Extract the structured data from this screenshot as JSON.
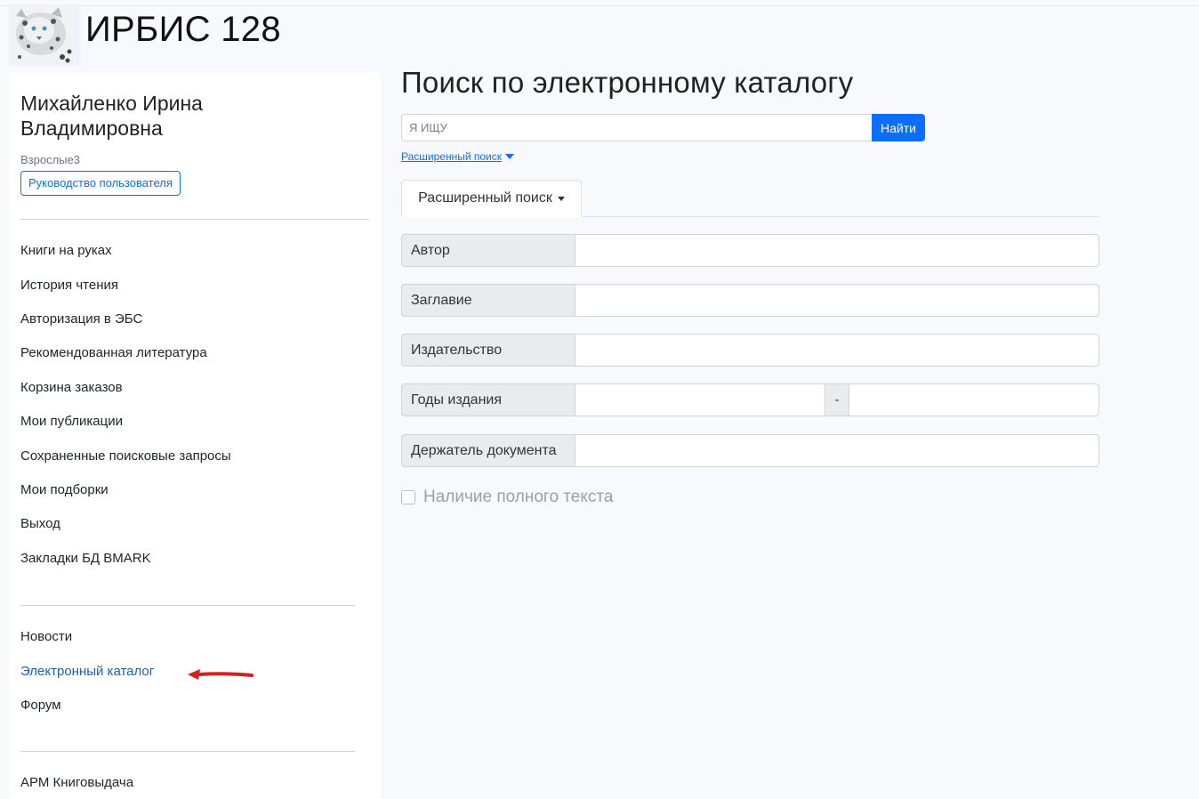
{
  "app": {
    "title": "ИРБИС 128",
    "logo_icon": "snow-leopard-logo"
  },
  "sidebar": {
    "user_name": "Михайленко Ирина Владимировна",
    "user_group": "Взрослые3",
    "guide_button": "Руководство пользователя",
    "menu": [
      "Книги на руках",
      "История чтения",
      "Авторизация в ЭБС",
      "Рекомендованная литература",
      "Корзина заказов",
      "Мои публикации",
      "Сохраненные поисковые запросы",
      "Мои подборки",
      "Выход",
      "Закладки БД BMARK"
    ],
    "links": [
      "Новости",
      "Электронный каталог",
      "Форум"
    ],
    "bottom": [
      "АРМ Книговыдача"
    ],
    "active_item": "Электронный каталог",
    "active_color": "#1d5fb8",
    "arrow_color": "#d42020"
  },
  "main": {
    "title": "Поиск по электронному каталогу",
    "search": {
      "placeholder": "Я ИЩУ",
      "button": "Найти"
    },
    "advanced_link": "Расширенный поиск",
    "tab_label": "Расширенный поиск",
    "fields": {
      "author": "Автор",
      "title": "Заглавие",
      "publisher": "Издательство",
      "years": "Годы издания",
      "year_separator": "-",
      "holder": "Держатель документа"
    },
    "fulltext_checkbox": "Наличие полного текста"
  },
  "colors": {
    "primary": "#0d6efd",
    "label_bg": "#e9ecef"
  }
}
